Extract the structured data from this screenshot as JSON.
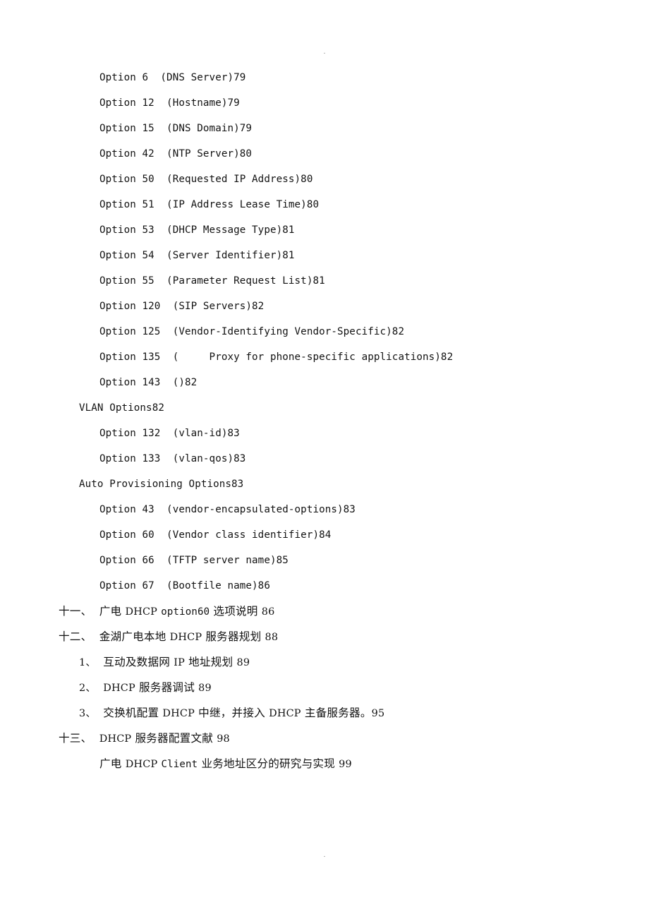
{
  "document": {
    "type": "table-of-contents",
    "language": "zh-CN",
    "header_mark": ".",
    "footer_mark": "."
  },
  "toc": {
    "entries": [
      {
        "id": "opt-6",
        "indent": 2,
        "script": "latin",
        "text": "Option 6  (DNS Server)79"
      },
      {
        "id": "opt-12",
        "indent": 2,
        "script": "latin",
        "text": "Option 12  (Hostname)79"
      },
      {
        "id": "opt-15",
        "indent": 2,
        "script": "latin",
        "text": "Option 15  (DNS Domain)79"
      },
      {
        "id": "opt-42",
        "indent": 2,
        "script": "latin",
        "text": "Option 42  (NTP Server)80"
      },
      {
        "id": "opt-50",
        "indent": 2,
        "script": "latin",
        "text": "Option 50  (Requested IP Address)80"
      },
      {
        "id": "opt-51",
        "indent": 2,
        "script": "latin",
        "text": "Option 51  (IP Address Lease Time)80"
      },
      {
        "id": "opt-53",
        "indent": 2,
        "script": "latin",
        "text": "Option 53  (DHCP Message Type)81"
      },
      {
        "id": "opt-54",
        "indent": 2,
        "script": "latin",
        "text": "Option 54  (Server Identifier)81"
      },
      {
        "id": "opt-55",
        "indent": 2,
        "script": "latin",
        "text": "Option 55  (Parameter Request List)81"
      },
      {
        "id": "opt-120",
        "indent": 2,
        "script": "latin",
        "text": "Option 120  (SIP Servers)82"
      },
      {
        "id": "opt-125",
        "indent": 2,
        "script": "latin",
        "text": "Option 125  (Vendor-Identifying Vendor-Specific)82"
      },
      {
        "id": "opt-135",
        "indent": 2,
        "script": "latin",
        "text": "Option 135  (     Proxy for phone-specific applications)82"
      },
      {
        "id": "opt-143",
        "indent": 2,
        "script": "latin",
        "text": "Option 143  ()82"
      },
      {
        "id": "vlan-options",
        "indent": 1,
        "script": "latin",
        "text": "VLAN Options82"
      },
      {
        "id": "opt-132",
        "indent": 2,
        "script": "latin",
        "text": "Option 132  (vlan-id)83"
      },
      {
        "id": "opt-133",
        "indent": 2,
        "script": "latin",
        "text": "Option 133  (vlan-qos)83"
      },
      {
        "id": "auto-provisioning-options",
        "indent": 1,
        "script": "latin",
        "text": "Auto Provisioning Options83"
      },
      {
        "id": "opt-43",
        "indent": 2,
        "script": "latin",
        "text": "Option 43  (vendor-encapsulated-options)83"
      },
      {
        "id": "opt-60",
        "indent": 2,
        "script": "latin",
        "text": "Option 60  (Vendor class identifier)84"
      },
      {
        "id": "opt-66",
        "indent": 2,
        "script": "latin",
        "text": "Option 66  (TFTP server name)85"
      },
      {
        "id": "opt-67",
        "indent": 2,
        "script": "latin",
        "text": "Option 67  (Bootfile name)86"
      },
      {
        "id": "chap-11",
        "indent": 0,
        "script": "cjk",
        "parts": [
          {
            "kind": "cjk",
            "text": "十一、"
          },
          {
            "kind": "gap",
            "text": "  "
          },
          {
            "kind": "cjk",
            "text": "广电 "
          },
          {
            "kind": "lat",
            "text": "DHCP"
          },
          {
            "kind": "gap",
            "text": " "
          },
          {
            "kind": "latmono",
            "text": "option60"
          },
          {
            "kind": "cjk",
            "text": " 选项说明 "
          },
          {
            "kind": "lat",
            "text": "86"
          }
        ]
      },
      {
        "id": "chap-12",
        "indent": 0,
        "script": "cjk",
        "parts": [
          {
            "kind": "cjk",
            "text": "十二、"
          },
          {
            "kind": "gap",
            "text": "  "
          },
          {
            "kind": "cjk",
            "text": "金湖广电本地 "
          },
          {
            "kind": "lat",
            "text": "DHCP"
          },
          {
            "kind": "cjk",
            "text": " 服务器规划 "
          },
          {
            "kind": "lat",
            "text": "88"
          }
        ]
      },
      {
        "id": "chap-12-1",
        "indent": 1,
        "script": "cjk",
        "parts": [
          {
            "kind": "lat",
            "text": "1、"
          },
          {
            "kind": "gap",
            "text": "  "
          },
          {
            "kind": "cjk",
            "text": "互动及数据网 "
          },
          {
            "kind": "lat",
            "text": "IP"
          },
          {
            "kind": "cjk",
            "text": " 地址规划 "
          },
          {
            "kind": "lat",
            "text": "89"
          }
        ]
      },
      {
        "id": "chap-12-2",
        "indent": 1,
        "script": "cjk",
        "parts": [
          {
            "kind": "lat",
            "text": "2、"
          },
          {
            "kind": "gap",
            "text": "  "
          },
          {
            "kind": "lat",
            "text": "DHCP"
          },
          {
            "kind": "cjk",
            "text": " 服务器调试 "
          },
          {
            "kind": "lat",
            "text": "89"
          }
        ]
      },
      {
        "id": "chap-12-3",
        "indent": 1,
        "script": "cjk",
        "parts": [
          {
            "kind": "lat",
            "text": "3、"
          },
          {
            "kind": "gap",
            "text": "  "
          },
          {
            "kind": "cjk",
            "text": "交换机配置 "
          },
          {
            "kind": "lat",
            "text": "DHCP"
          },
          {
            "kind": "cjk",
            "text": " 中继，并接入 "
          },
          {
            "kind": "lat",
            "text": "DHCP"
          },
          {
            "kind": "cjk",
            "text": " 主备服务器。"
          },
          {
            "kind": "lat",
            "text": "95"
          }
        ]
      },
      {
        "id": "chap-13",
        "indent": 0,
        "script": "cjk",
        "parts": [
          {
            "kind": "cjk",
            "text": "十三、"
          },
          {
            "kind": "gap",
            "text": "  "
          },
          {
            "kind": "lat",
            "text": "DHCP"
          },
          {
            "kind": "cjk",
            "text": " 服务器配置文献 "
          },
          {
            "kind": "lat",
            "text": "98"
          }
        ]
      },
      {
        "id": "chap-13-ref",
        "indent": 2,
        "script": "cjk",
        "parts": [
          {
            "kind": "cjk",
            "text": "广电 "
          },
          {
            "kind": "lat",
            "text": "DHCP"
          },
          {
            "kind": "gap",
            "text": " "
          },
          {
            "kind": "latmono",
            "text": "Client"
          },
          {
            "kind": "cjk",
            "text": " 业务地址区分的研究与实现 "
          },
          {
            "kind": "lat",
            "text": "99"
          }
        ]
      }
    ]
  }
}
